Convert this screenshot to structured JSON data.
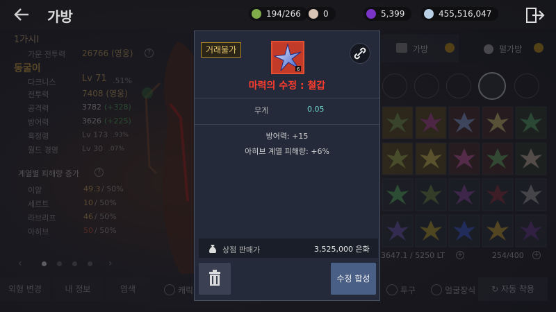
{
  "header": {
    "title": "가방",
    "resources": [
      {
        "name": "weight",
        "value": "194/266",
        "color": "#7fae4a"
      },
      {
        "name": "pearl",
        "value": "0",
        "color": "#d8c4b4"
      },
      {
        "name": "gem",
        "value": "5,399",
        "color": "#7a35c8"
      },
      {
        "name": "silver",
        "value": "455,516,047",
        "color": "#b8cfe6"
      }
    ]
  },
  "character": {
    "family_name": "1가시I",
    "family_power_label": "가문 전투력",
    "family_power_value": "26766 (영웅)",
    "char_name": "동굴이",
    "class": "다크니스",
    "level_label": "Lv 71",
    "level_pct": ".51%",
    "stats": [
      {
        "label": "전투력",
        "value": "7408 (영웅)",
        "extra": ""
      },
      {
        "label": "공격력",
        "value": "3782",
        "extra": "(+328)"
      },
      {
        "label": "방어력",
        "value": "3626",
        "extra": "(+225)"
      },
      {
        "label": "흑정령",
        "value": "Lv 173",
        "extra": ".93%"
      },
      {
        "label": "월드 경영",
        "value": "Lv 30",
        "extra": ".07%"
      }
    ],
    "faction_title": "계열별 피해량 증가",
    "factions": [
      {
        "label": "이알",
        "value": "49.3",
        "max": "/ 50%"
      },
      {
        "label": "세르트",
        "value": "10",
        "max": "/ 50%"
      },
      {
        "label": "라브리프",
        "value": "46",
        "max": "/ 50%"
      },
      {
        "label": "아히브",
        "value": "50",
        "max": "/ 50%"
      }
    ]
  },
  "bottom": {
    "appearance": "외형 변경",
    "myinfo": "내 정보",
    "dye": "염색",
    "character": "캐릭",
    "helmet": "투구",
    "face": "얼굴장식",
    "auto_equip": "자동 착용"
  },
  "inventory": {
    "tab_bag": "가방",
    "tab_pearl": "펄가방",
    "weight": "3647.1 / 5250 LT",
    "slots": "254/400"
  },
  "tooltip": {
    "trade_tag": "거래불가",
    "item_name": "마력의 수정 : 철갑",
    "weight_label": "무게",
    "weight_value": "0.05",
    "stat1": "방어력: +15",
    "stat2": "아히브 계열 피해량: +6%",
    "sell_label": "상점 판매가",
    "sell_value": "3,525,000 은화",
    "synth_button": "수정 합성"
  }
}
